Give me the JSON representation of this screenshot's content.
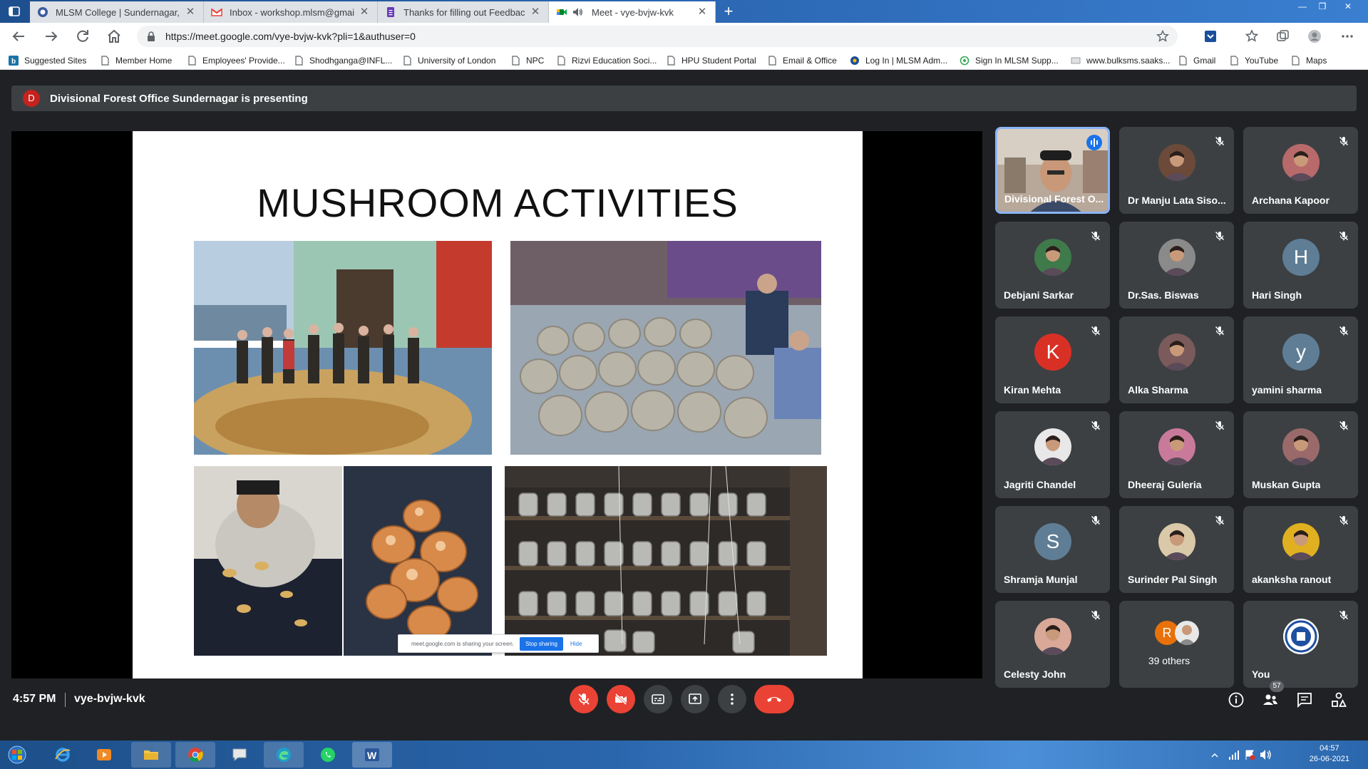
{
  "browser": {
    "tabs": [
      {
        "title": "MLSM College | Sundernagar, M",
        "icon": "college-favicon-icon",
        "active": false
      },
      {
        "title": "Inbox - workshop.mlsm@gmail.c",
        "icon": "gmail-icon",
        "active": false
      },
      {
        "title": "Thanks for filling out Feedback f",
        "icon": "google-forms-icon",
        "active": false
      },
      {
        "title": "Meet - vye-bvjw-kvk",
        "icon": "meet-icon",
        "active": true
      }
    ],
    "url": "https://meet.google.com/vye-bvjw-kvk?pli=1&authuser=0",
    "bookmarks": [
      "Suggested Sites",
      "Member Home",
      "Employees' Provide...",
      "Shodhganga@INFL...",
      "University of London",
      "NPC",
      "Rizvi Education Soci...",
      "HPU Student Portal",
      "Email & Office",
      "Log In | MLSM Adm...",
      "Sign In MLSM Supp...",
      "www.bulksms.saaks...",
      "Gmail",
      "YouTube",
      "Maps"
    ]
  },
  "meet": {
    "presenting_initial": "D",
    "presenting_text": "Divisional Forest Office Sundernagar is presenting",
    "slide_title": "MUSHROOM ACTIVITIES",
    "share_notice": "meet.google.com is sharing your screen.",
    "stop_sharing": "Stop sharing",
    "hide": "Hide",
    "time": "4:57 PM",
    "meeting_code": "vye-bvjw-kvk",
    "participant_count": "57",
    "participants": [
      {
        "name": "Divisional Forest O...",
        "type": "video",
        "muted": false,
        "speaking": true
      },
      {
        "name": "Dr Manju Lata Siso...",
        "type": "photo",
        "muted": true,
        "color": "#6b4a3a"
      },
      {
        "name": "Archana Kapoor",
        "type": "photo",
        "muted": true,
        "color": "#b86a6a"
      },
      {
        "name": "Debjani Sarkar",
        "type": "photo",
        "muted": true,
        "color": "#3f7a4a"
      },
      {
        "name": "Dr.Sas. Biswas",
        "type": "photo",
        "muted": true,
        "color": "#8a8a8a"
      },
      {
        "name": "Hari Singh",
        "type": "letter",
        "letter": "H",
        "muted": true,
        "color": "#5f7d95"
      },
      {
        "name": "Kiran Mehta",
        "type": "letter",
        "letter": "K",
        "muted": true,
        "color": "#d93025"
      },
      {
        "name": "Alka Sharma",
        "type": "photo",
        "muted": true,
        "color": "#7a5a5a"
      },
      {
        "name": "yamini sharma",
        "type": "letter",
        "letter": "y",
        "muted": true,
        "color": "#5f7d95"
      },
      {
        "name": "Jagriti Chandel",
        "type": "photo",
        "muted": true,
        "color": "#e8e8e8"
      },
      {
        "name": "Dheeraj Guleria",
        "type": "photo",
        "muted": true,
        "color": "#c97a9a"
      },
      {
        "name": "Muskan Gupta",
        "type": "photo",
        "muted": true,
        "color": "#9a6a6a"
      },
      {
        "name": "Shramja Munjal",
        "type": "letter",
        "letter": "S",
        "muted": true,
        "color": "#5f7d95"
      },
      {
        "name": "Surinder Pal Singh",
        "type": "photo",
        "muted": true,
        "color": "#d9c9a8"
      },
      {
        "name": "akanksha ranout",
        "type": "photo",
        "muted": true,
        "color": "#e0b020"
      },
      {
        "name": "Celesty John",
        "type": "photo",
        "muted": true,
        "color": "#d9a898"
      },
      {
        "name": "39 others",
        "type": "others",
        "letter": "R",
        "muted": false,
        "color": "#e8710a"
      },
      {
        "name": "You",
        "type": "emblem",
        "muted": true,
        "color": "#1f4fa0"
      }
    ]
  },
  "taskbar": {
    "time": "04:57",
    "date": "26-06-2021"
  }
}
